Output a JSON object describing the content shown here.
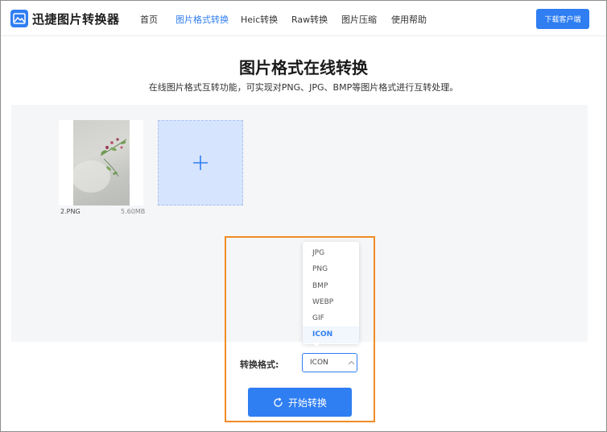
{
  "app": {
    "name": "迅捷图片转换器"
  },
  "nav": {
    "items": [
      {
        "label": "首页",
        "active": false
      },
      {
        "label": "图片格式转换",
        "active": true
      },
      {
        "label": "Heic转换",
        "active": false
      },
      {
        "label": "Raw转换",
        "active": false
      },
      {
        "label": "图片压缩",
        "active": false
      },
      {
        "label": "使用帮助",
        "active": false
      }
    ],
    "download_label": "下载客户端"
  },
  "page": {
    "title": "图片格式在线转换",
    "subtitle": "在线图片格式互转功能，可实现对PNG、JPG、BMP等图片格式进行互转处理。"
  },
  "file": {
    "name": "2.PNG",
    "size": "5.60MB"
  },
  "add_icon": "plus-icon",
  "format": {
    "label": "转换格式:",
    "selected": "ICON",
    "options": [
      "JPG",
      "PNG",
      "BMP",
      "WEBP",
      "GIF",
      "ICON"
    ]
  },
  "start_button": {
    "label": "开始转换",
    "icon": "refresh-icon"
  },
  "colors": {
    "accent": "#2f7ef2",
    "highlight": "#f18c25",
    "upload_bg": "#d6e4fd",
    "work_area_bg": "#f5f6f8"
  }
}
